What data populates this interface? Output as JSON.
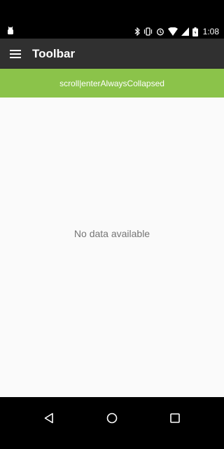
{
  "status_bar": {
    "time": "1:08",
    "icons": [
      "android-debug-icon",
      "bluetooth-icon",
      "vibrate-icon",
      "alarm-icon",
      "wifi-icon",
      "signal-icon",
      "battery-icon"
    ]
  },
  "toolbar": {
    "title": "Toolbar",
    "menu_icon": "hamburger-menu-icon",
    "background": "#303030"
  },
  "sub_bar": {
    "label": "scroll|enterAlwaysCollapsed",
    "background": "#8bc34a"
  },
  "content": {
    "empty_message": "No data available"
  },
  "nav_bar": {
    "buttons": [
      "back-icon",
      "home-icon",
      "recents-icon"
    ]
  }
}
